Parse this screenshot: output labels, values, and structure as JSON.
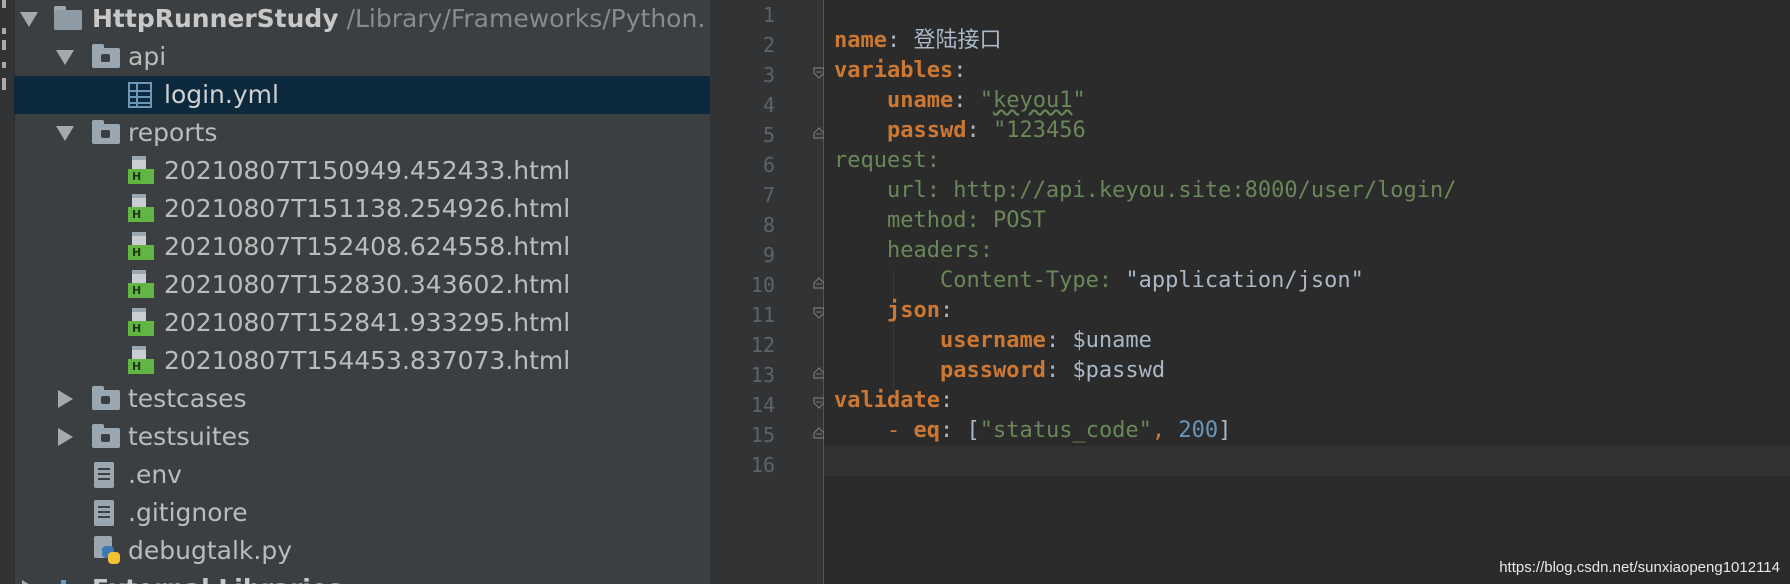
{
  "project": {
    "root": {
      "name": "HttpRunnerStudy",
      "path": "/Library/Frameworks/Python."
    },
    "api_folder": "api",
    "api_file": "login.yml",
    "reports_folder": "reports",
    "reports": [
      "20210807T150949.452433.html",
      "20210807T151138.254926.html",
      "20210807T152408.624558.html",
      "20210807T152830.343602.html",
      "20210807T152841.933295.html",
      "20210807T154453.837073.html"
    ],
    "collapsed_folders": [
      "testcases",
      "testsuites"
    ],
    "files": [
      {
        "name": ".env",
        "icon": "text-file-icon"
      },
      {
        "name": ".gitignore",
        "icon": "text-file-icon"
      },
      {
        "name": "debugtalk.py",
        "icon": "python-file-icon"
      }
    ],
    "external_libraries": "External Libraries"
  },
  "editor": {
    "line_numbers": [
      "1",
      "2",
      "3",
      "4",
      "5",
      "6",
      "7",
      "8",
      "9",
      "10",
      "11",
      "12",
      "13",
      "14",
      "15",
      "16"
    ],
    "lines": {
      "l2_key": "name",
      "l2_colon": ":",
      "l2_value": "登陆接口",
      "l3_key": "variables",
      "l3_colon": ":",
      "l4_key": "uname",
      "l4_colon": ":",
      "l4_quote": "\"",
      "l4_value": "keyou1",
      "l4_quote_end": "\"",
      "l5_key": "passwd",
      "l5_colon": ":",
      "l5_value": "\"123456",
      "l6_text": "request:",
      "l7_key": "url:",
      "l7_value": "http://api.keyou.site:8000/user/login/",
      "l8_text": "method: POST",
      "l9_text": "headers:",
      "l10_key": "Content-Type:",
      "l10_quote": "\"",
      "l10_value": "application/json\"",
      "l11_key": "json",
      "l11_colon": ":",
      "l12_key": "username",
      "l12_colon": ":",
      "l12_value": "$uname",
      "l13_key": "password",
      "l13_colon": ":",
      "l13_value": "$passwd",
      "l14_key": "validate",
      "l14_colon": ":",
      "l15_dash": "- ",
      "l15_key": "eq",
      "l15_colon": ":",
      "l15_open": "[",
      "l15_str": "\"status_code\"",
      "l15_comma": ",",
      "l15_num": "200",
      "l15_close": "]"
    }
  },
  "watermark": "https://blog.csdn.net/sunxiaopeng1012114",
  "colors": {
    "tree_bg": "#3c3f41",
    "editor_bg": "#2b2b2b",
    "selection": "#0d293e",
    "keyword": "#cc7832",
    "string": "#6a8759",
    "number": "#6897bb",
    "text": "#a9b7c6"
  }
}
